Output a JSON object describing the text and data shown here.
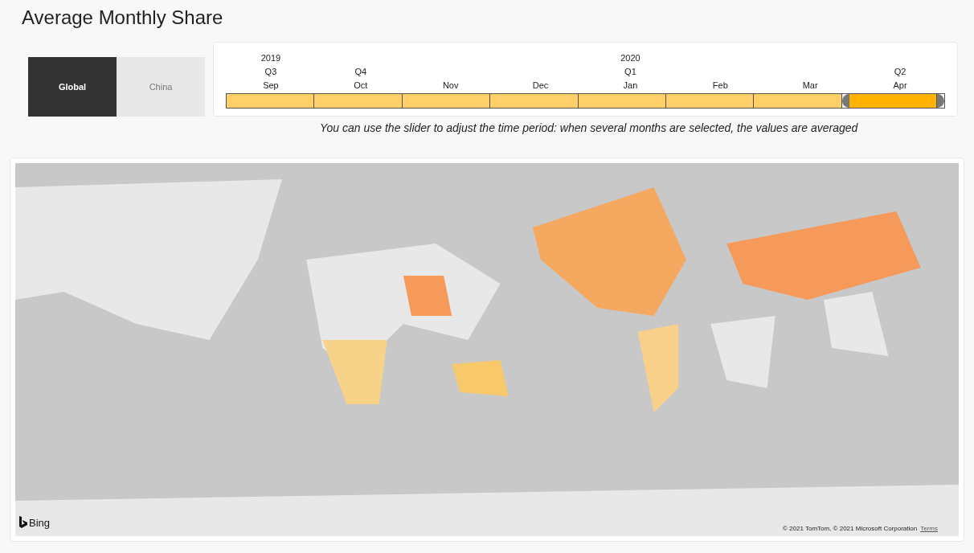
{
  "title": "Average Monthly Share",
  "slicer": [
    {
      "label": "Global",
      "selected": true
    },
    {
      "label": "China",
      "selected": false
    }
  ],
  "timeline": {
    "months": [
      {
        "year": "2019",
        "quarter": "Q3",
        "label": "Sep",
        "selected": false
      },
      {
        "quarter": "Q4",
        "label": "Oct",
        "selected": false
      },
      {
        "label": "Nov",
        "selected": false
      },
      {
        "label": "Dec",
        "selected": false
      },
      {
        "year": "2020",
        "quarter": "Q1",
        "label": "Jan",
        "selected": false
      },
      {
        "label": "Feb",
        "selected": false
      },
      {
        "label": "Mar",
        "selected": false
      },
      {
        "quarter": "Q2",
        "label": "Apr",
        "selected": true
      }
    ],
    "hint": "You can use the slider to adjust the time period: when several months are selected, the values are averaged"
  },
  "map": {
    "logo": "Bing",
    "copyright": "© 2021 TomTom, © 2021 Microsoft Corporation",
    "terms": "Terms"
  }
}
